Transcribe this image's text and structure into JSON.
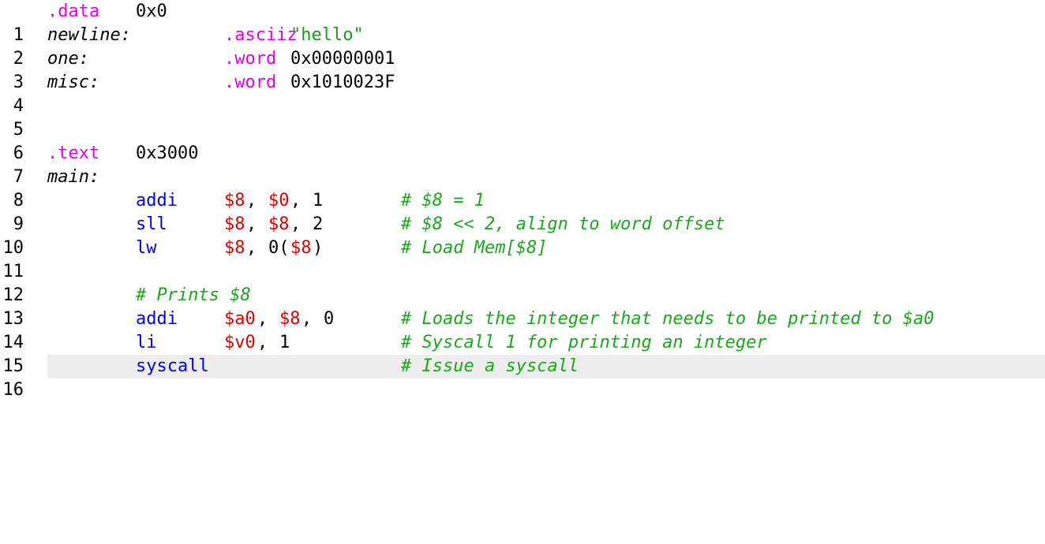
{
  "line_numbers": [
    "1",
    "2",
    "3",
    "4",
    "5",
    "6",
    "7",
    "8",
    "9",
    "10",
    "11",
    "12",
    "13",
    "14",
    "15",
    "16"
  ],
  "current_line": "16",
  "code": {
    "l1": {
      "dir": ".data",
      "addr": "0x0"
    },
    "l2": {
      "label": "newline:",
      "dir": ".asciiz",
      "str": "\"hello\""
    },
    "l3": {
      "label": "one:",
      "dir": ".word",
      "val": "0x00000001"
    },
    "l4": {
      "label": "misc:",
      "dir": ".word",
      "val": "0x1010023F"
    },
    "l7": {
      "dir": ".text",
      "addr": "0x3000"
    },
    "l8": {
      "label": "main:"
    },
    "l9": {
      "ins": "addi",
      "r1": "$8",
      "p1": ",",
      "r2": "$0",
      "p2": ",",
      "imm": "1",
      "comment": "# $8 = 1"
    },
    "l10": {
      "ins": "sll",
      "r1": "$8",
      "p1": ",",
      "r2": "$8",
      "p2": ",",
      "imm": "2",
      "comment": "# $8 << 2, align to word offset"
    },
    "l11": {
      "ins": "lw",
      "r1": "$8",
      "p1": ",",
      "off": "0(",
      "r2": "$8",
      "p2": ")",
      "comment": "# Load Mem[$8]"
    },
    "l13": {
      "comment": "# Prints $8"
    },
    "l14": {
      "ins": "addi",
      "r1": "$a0",
      "p1": ",",
      "r2": "$8",
      "p2": ",",
      "imm": "0",
      "comment": "# Loads the integer that needs to be printed to $a0"
    },
    "l15": {
      "ins": "li",
      "r1": "$v0",
      "p1": ",",
      "imm": "1",
      "comment": "# Syscall 1 for printing an integer"
    },
    "l16": {
      "ins": "syscall",
      "comment": "# Issue a syscall"
    }
  }
}
